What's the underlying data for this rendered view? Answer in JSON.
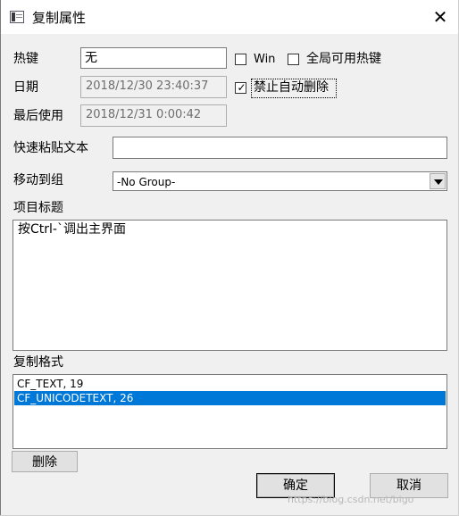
{
  "window": {
    "title": "复制属性",
    "close_symbol": "✕"
  },
  "hotkey": {
    "label": "热键",
    "value": "无"
  },
  "win_checkbox": {
    "label": "Win",
    "checked": false
  },
  "global_checkbox": {
    "label": "全局可用热键",
    "checked": false
  },
  "date": {
    "label": "日期",
    "value": "2018/12/30 23:40:37"
  },
  "no_auto_delete": {
    "label": "禁止自动删除",
    "checked": true,
    "check_symbol": "✓"
  },
  "last_used": {
    "label": "最后使用",
    "value": "2018/12/31 0:00:42"
  },
  "quick_paste": {
    "label": "快速粘贴文本",
    "value": ""
  },
  "move_to_group": {
    "label": "移动到组",
    "value": "-No Group-"
  },
  "item_title": {
    "label": "项目标题",
    "value": "按Ctrl-`调出主界面"
  },
  "copy_formats": {
    "label": "复制格式",
    "items": [
      "CF_TEXT, 19",
      "CF_UNICODETEXT, 26"
    ],
    "selected_index": 1
  },
  "buttons": {
    "delete": "删除",
    "ok": "确定",
    "cancel": "取消"
  },
  "watermark": "https://blog.csdn.net/bigo",
  "colors": {
    "selection": "#0078d7",
    "background": "#f0f0f0"
  }
}
